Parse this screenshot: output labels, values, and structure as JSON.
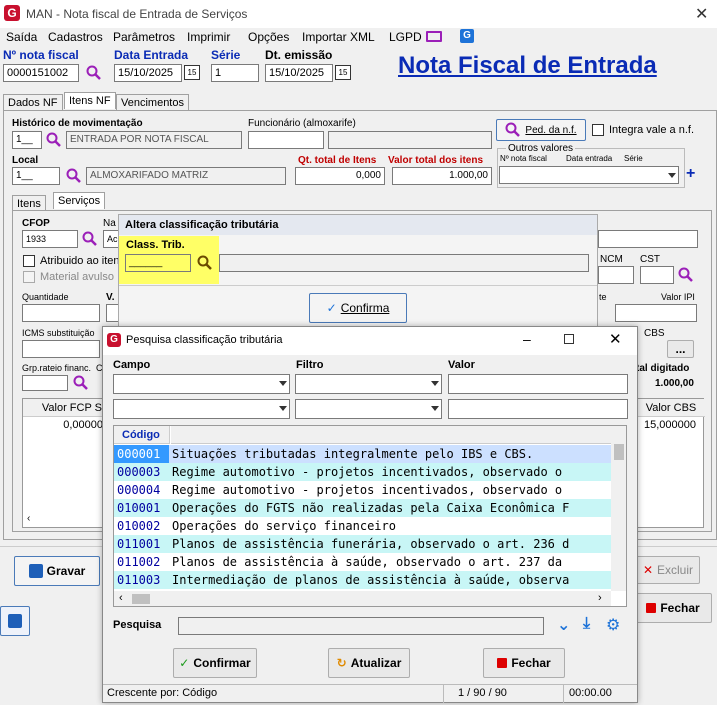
{
  "window": {
    "title": "MAN - Nota fiscal de Entrada de Serviços"
  },
  "menu": [
    "Saída",
    "Cadastros",
    "Parâmetros",
    "Imprimir",
    "Opções",
    "Importar XML",
    "LGPD"
  ],
  "header": {
    "nf_label": "Nº nota fiscal",
    "nf_value": "0000151002",
    "data_entrada_label": "Data Entrada",
    "data_entrada_value": "15/10/2025",
    "serie_label": "Série",
    "serie_value": "1",
    "dt_emissao_label": "Dt. emissão",
    "dt_emissao_value": "15/10/2025",
    "big_title": "Nota Fiscal de Entrada",
    "cal_label": "15"
  },
  "tabs": [
    "Dados NF",
    "Itens NF",
    "Vencimentos"
  ],
  "itens": {
    "historico_label": "Histórico de movimentação",
    "historico_code": "1__",
    "historico_desc": "ENTRADA POR NOTA FISCAL",
    "funcionario_label": "Funcionário (almoxarife)",
    "ped_button": "Ped. da n.f.",
    "integra_label": "Integra vale a n.f.",
    "local_label": "Local",
    "local_code": "1__",
    "local_desc": "ALMOXARIFADO MATRIZ",
    "qt_total_label": "Qt. total de Itens",
    "qt_total_value": "0,000",
    "valor_total_label": "Valor total dos itens",
    "valor_total_value": "1.000,00",
    "outros_label": "Outros valores",
    "outros_cols": [
      "Nº nota fiscal",
      "Data entrada",
      "Série"
    ]
  },
  "subtabs": [
    "Itens",
    "Serviços"
  ],
  "servicos": {
    "cfop_label": "CFOP",
    "cfop_value": "1933",
    "na_label": "Na",
    "ac_value": "Ac",
    "atribuido_label": "Atribuido ao iten",
    "material_label": "Material avulso",
    "ncm_label": "NCM",
    "cst_label": "CST",
    "quantidade_label": "Quantidade",
    "v_label": "V.",
    "te_label": "te",
    "valor_ipi_label": "Valor IPI",
    "icms_label": "ICMS substituição",
    "cbs_label": "CBS",
    "grp_label": "Grp.rateio financ.",
    "c_label": "C",
    "total_digitado_label": "tal digitado",
    "total_digitado_value": "1.000,00",
    "fcp_header": "Valor FCP S",
    "fcp_value": "0,00000",
    "cbs_header": "Valor CBS",
    "cbs_value": "15,000000",
    "dots": "..."
  },
  "footer": {
    "gravar": "Gravar",
    "excluir": "Excluir",
    "fechar": "Fechar"
  },
  "altera": {
    "title": "Altera classificação tributária",
    "class_label": "Class. Trib.",
    "class_value": "______",
    "confirma": "Confirma"
  },
  "pesquisa": {
    "title": "Pesquisa classificação tributária",
    "campo_label": "Campo",
    "filtro_label": "Filtro",
    "valor_label": "Valor",
    "col_codigo": "Código",
    "rows": [
      {
        "code": "000001",
        "desc": "Situações tributadas integralmente pelo IBS e CBS."
      },
      {
        "code": "000003",
        "desc": "Regime automotivo - projetos incentivados, observado o"
      },
      {
        "code": "000004",
        "desc": "Regime automotivo - projetos incentivados, observado o"
      },
      {
        "code": "010001",
        "desc": "Operações do FGTS não realizadas pela Caixa Econômica F"
      },
      {
        "code": "010002",
        "desc": "Operações do serviço financeiro"
      },
      {
        "code": "011001",
        "desc": "Planos de assistência funerária, observado o art. 236 d"
      },
      {
        "code": "011002",
        "desc": "Planos de assistência à saúde, observado o art. 237 da"
      },
      {
        "code": "011003",
        "desc": "Intermediação de planos de assistência à saúde, observa"
      }
    ],
    "pesquisa_label": "Pesquisa",
    "confirmar": "Confirmar",
    "atualizar": "Atualizar",
    "fechar": "Fechar",
    "status_order": "Crescente por: Código",
    "status_count": "1 / 90 / 90",
    "status_time": "00:00.00"
  },
  "colors": {
    "accent": "#0a2bb5",
    "highlight": "#ffff66",
    "selected": "#3399ff",
    "cyan_row": "#c8f6f6"
  }
}
